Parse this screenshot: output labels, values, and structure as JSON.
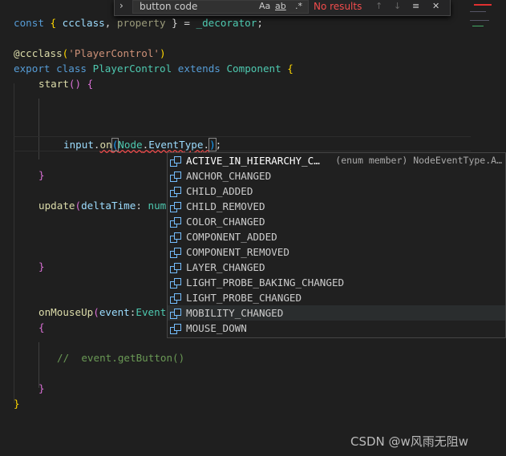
{
  "find_widget": {
    "value": "button code",
    "case_label": "Aa",
    "word_label": "ab",
    "regex_label": ".*",
    "results": "No results",
    "prev_icon": "arrow-up-icon",
    "next_icon": "arrow-down-icon",
    "selection_icon": "list-icon",
    "close_icon": "close-icon"
  },
  "code": {
    "l1": {
      "a": "const",
      "b": " { ",
      "c": "ccclass",
      "d": ", ",
      "e": "property",
      "f": " } = ",
      "g": "_decorator",
      "h": ";"
    },
    "l2": {
      "a": "@ccclass",
      "b": "(",
      "c": "'PlayerControl'",
      "d": ")"
    },
    "l3": {
      "a": "export",
      "b": " ",
      "c": "class",
      "d": " ",
      "e": "PlayerControl",
      "f": " ",
      "g": "extends",
      "h": " ",
      "i": "Component",
      "j": " {"
    },
    "l4": {
      "a": "start",
      "b": "() {"
    },
    "l5": {
      "a": "input",
      "b": ".",
      "c": "on",
      "d": "(",
      "e": "Node",
      "f": ".",
      "g": "EventType",
      "h": ".",
      "i": ")",
      "j": ";"
    },
    "l6": "}",
    "l7": {
      "a": "update",
      "b": "(",
      "c": "deltaTime",
      "d": ": ",
      "e": "num"
    },
    "l8": "}",
    "l9": {
      "a": "onMouseUp",
      "b": "(",
      "c": "event",
      "d": ":",
      "e": "Event"
    },
    "l10": "{",
    "l11": "//  event.getButton()",
    "l12": "}",
    "l13": "}"
  },
  "suggestions": {
    "items": [
      "ACTIVE_IN_HIERARCHY_C…",
      "ANCHOR_CHANGED",
      "CHILD_ADDED",
      "CHILD_REMOVED",
      "COLOR_CHANGED",
      "COMPONENT_ADDED",
      "COMPONENT_REMOVED",
      "LAYER_CHANGED",
      "LIGHT_PROBE_BAKING_CHANGED",
      "LIGHT_PROBE_CHANGED",
      "MOBILITY_CHANGED",
      "MOUSE_DOWN"
    ],
    "selected_detail": "(enum member) NodeEventType.A…",
    "item_icon": "enum-member-icon"
  },
  "watermark": "CSDN @w风雨无阻w"
}
